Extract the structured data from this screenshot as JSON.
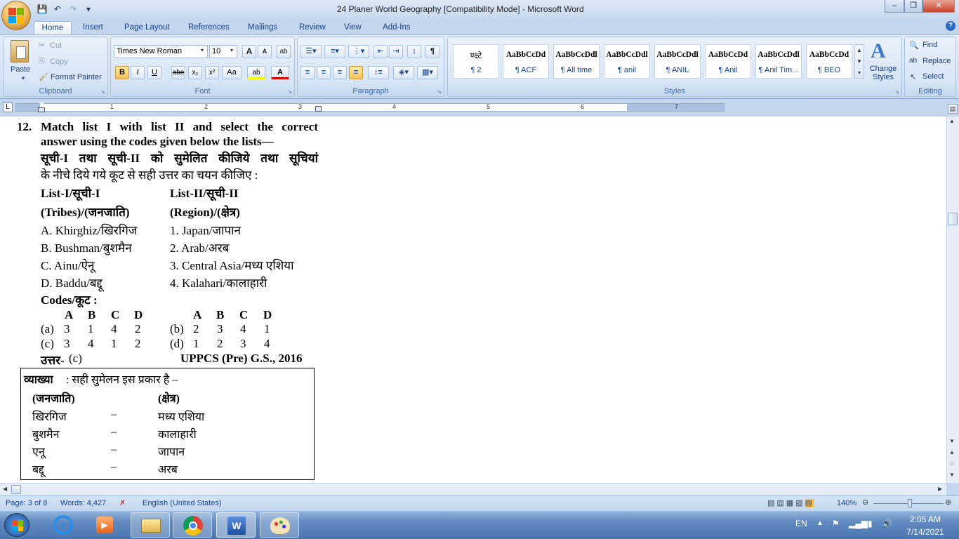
{
  "window": {
    "title": "24 Planer World Geography [Compatibility Mode] - Microsoft Word",
    "controls": {
      "minimize": "–",
      "restore": "❐",
      "close": "✕"
    }
  },
  "quick_access": {
    "save_icon": "💾",
    "undo_icon": "↶",
    "redo_icon": "↷",
    "customize_icon": "▾"
  },
  "tabs": [
    "Home",
    "Insert",
    "Page Layout",
    "References",
    "Mailings",
    "Review",
    "View",
    "Add-Ins"
  ],
  "help_icon": "?",
  "clipboard": {
    "paste_label": "Paste",
    "cut_label": "Cut",
    "copy_label": "Copy",
    "format_painter_label": "Format Painter",
    "group_label": "Clipboard"
  },
  "font": {
    "font_name": "Times New Roman",
    "font_size": "10",
    "grow_label": "A",
    "shrink_label": "A",
    "clear_label": "ab",
    "bold": "B",
    "italic": "I",
    "underline": "U",
    "strike": "abe",
    "subscript": "x₂",
    "superscript": "x²",
    "change_case": "Aa",
    "highlight": "ab",
    "font_color": "A",
    "group_label": "Font"
  },
  "paragraph": {
    "group_label": "Paragraph",
    "show_marks": "¶"
  },
  "styles": {
    "items": [
      {
        "preview": "ण्क्ष्टे",
        "label": "¶ 2"
      },
      {
        "preview": "AaBbCcDd",
        "label": "¶ ACF"
      },
      {
        "preview": "AaBbCcDdl",
        "label": "¶ All time"
      },
      {
        "preview": "AaBbCcDdl",
        "label": "¶ anil"
      },
      {
        "preview": "AaBbCcDdl",
        "label": "¶ ANIL"
      },
      {
        "preview": "AaBbCcDd",
        "label": "¶ Anil"
      },
      {
        "preview": "AaBbCcDdl",
        "label": "¶ Anil Tim..."
      },
      {
        "preview": "AaBbCcDd",
        "label": "¶ BEO"
      }
    ],
    "change_styles_label": "Change Styles",
    "group_label": "Styles"
  },
  "editing": {
    "find_label": "Find",
    "replace_label": "Replace",
    "select_label": "Select",
    "group_label": "Editing"
  },
  "ruler": {
    "numbers": [
      "1",
      "2",
      "3",
      "4",
      "5",
      "6",
      "7"
    ]
  },
  "document": {
    "q_number": "12.",
    "q_line1": "Match list I with list II and select the correct",
    "q_line2": "answer using the codes given below the lists—",
    "q_line3": "सूची-I तथा सूची-II को सुमेलित कीजिये तथा सूचियां",
    "q_line4": "के नीचे दिये गये कूट से सही उत्तर का चयन कीजिए :",
    "list1_head": "List-I/सूची-I",
    "list2_head": "List-II/सूची-II",
    "list1_sub": "(Tribes)/(जनजाति)",
    "list2_sub": "(Region)/(क्षेत्र)",
    "list1": [
      "A. Khirghiz/खिरगिज",
      "B. Bushman/बुशमैन",
      "C. Ainu/ऐनू",
      "D. Baddu/बद्दू"
    ],
    "list2": [
      "1. Japan/जापान",
      "2. Arab/अरब",
      "3. Central Asia/मध्य एशिया",
      "4. Kalahari/कालाहारी"
    ],
    "codes_label": "Codes/कूट :",
    "code_headers": [
      "A",
      "B",
      "C",
      "D"
    ],
    "options": [
      {
        "label": "(a)",
        "values": [
          "3",
          "1",
          "4",
          "2"
        ]
      },
      {
        "label": "(b)",
        "values": [
          "2",
          "3",
          "4",
          "1"
        ]
      },
      {
        "label": "(c)",
        "values": [
          "3",
          "4",
          "1",
          "2"
        ]
      },
      {
        "label": "(d)",
        "values": [
          "1",
          "2",
          "3",
          "4"
        ]
      }
    ],
    "answer_label": "उत्तर-",
    "answer_value": "(c)",
    "source": "UPPCS (Pre) G.S., 2016",
    "explain_label": "व्याख्या",
    "explain_text": ": सही सुमेलन इस प्रकार है –",
    "explain_head1": "(जनजाति)",
    "explain_head2": "(क्षेत्र)",
    "explain_rows": [
      {
        "tribe": "खिरगिज",
        "dash": "–",
        "region": "मध्य एशिया"
      },
      {
        "tribe": "बुशमैन",
        "dash": "–",
        "region": "कालाहारी"
      },
      {
        "tribe": "एनू",
        "dash": "–",
        "region": "जापान"
      },
      {
        "tribe": "बद्दू",
        "dash": "–",
        "region": "अरब"
      }
    ]
  },
  "status": {
    "page": "Page: 3 of 8",
    "words": "Words: 4,427",
    "language": "English (United States)",
    "zoom": "140%"
  },
  "taskbar": {
    "lang": "EN",
    "time": "2:05 AM",
    "date": "7/14/2021"
  }
}
